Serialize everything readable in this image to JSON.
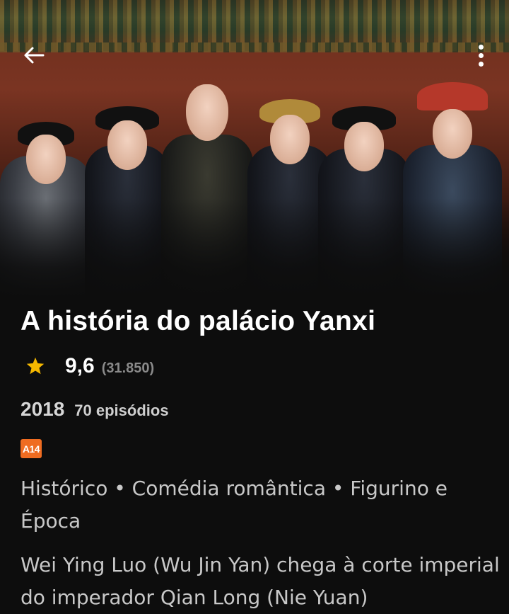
{
  "header": {
    "back_icon": "arrow-left-icon",
    "more_icon": "more-vertical-icon"
  },
  "hero": {
    "image_subject": "cast-poster"
  },
  "show": {
    "title": "A história do palácio Yanxi",
    "rating": "9,6",
    "rating_count": "(31.850)",
    "year": "2018",
    "episodes": "70 episódios",
    "age_rating": "A14",
    "genres": "Histórico • Comédia romântica • Figurino e Época",
    "synopsis": "Wei Ying Luo (Wu Jin Yan) chega à corte imperial do imperador Qian Long (Nie Yuan)"
  },
  "colors": {
    "background": "#0d0d0d",
    "star": "#f5b800",
    "age_badge": "#ef6c21",
    "muted_text": "#8a8a8a"
  }
}
